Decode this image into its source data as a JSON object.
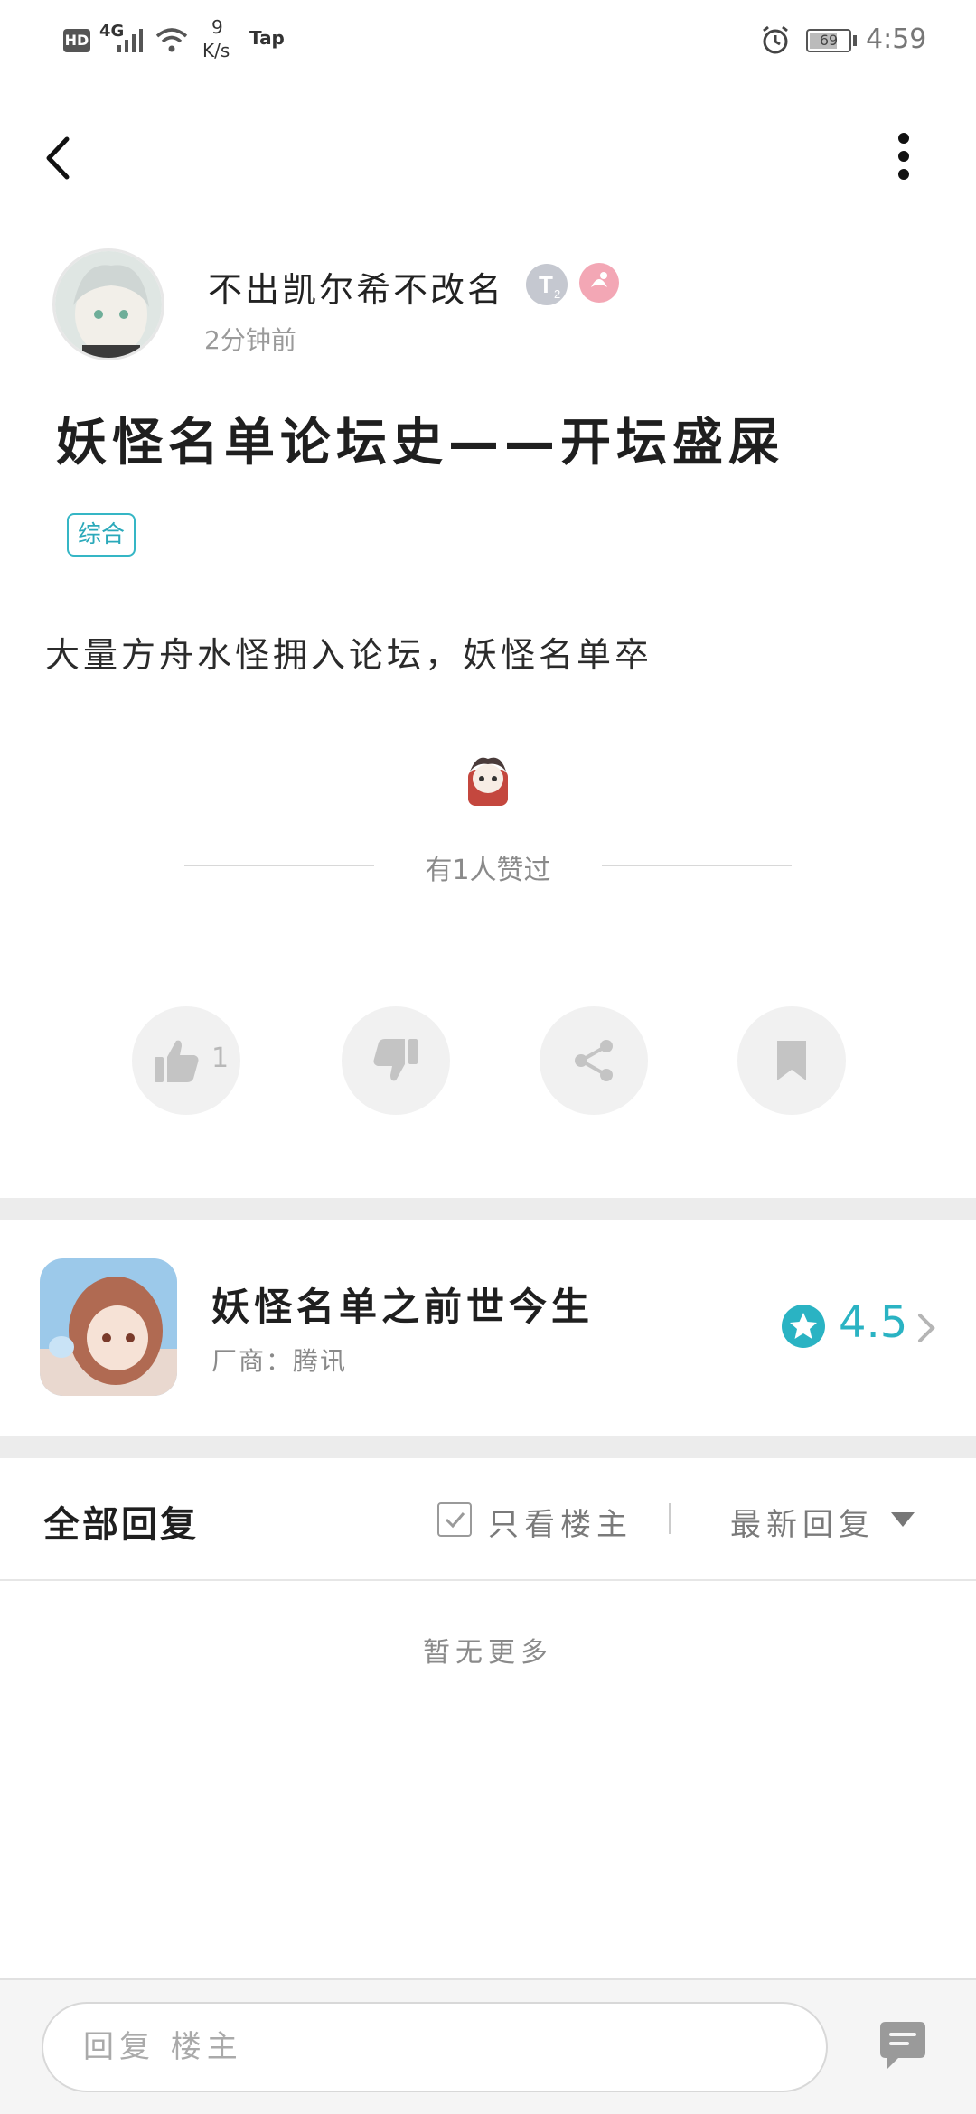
{
  "status_bar": {
    "network": "HD",
    "signal_type": "4G",
    "speed_value": "9",
    "speed_unit": "K/s",
    "app_badge": "Tap",
    "battery": "69",
    "time": "4:59"
  },
  "post": {
    "author": "不出凯尔希不改名",
    "time": "2分钟前",
    "title": "妖怪名单论坛史——开坛盛屎",
    "tag": "综合",
    "body": "大量方舟水怪拥入论坛，妖怪名单卒",
    "likes_text": "有1人赞过",
    "like_count": "1"
  },
  "game": {
    "name": "妖怪名单之前世今生",
    "vendor": "厂商：腾讯",
    "rating": "4.5"
  },
  "replies": {
    "title": "全部回复",
    "only_op": "只看楼主",
    "sort": "最新回复",
    "empty": "暂无更多"
  },
  "composer": {
    "placeholder": "回复 楼主"
  },
  "icons": {
    "back": "back-arrow-icon",
    "more": "more-vertical-icon",
    "like": "thumbs-up-icon",
    "dislike": "thumbs-down-icon",
    "share": "share-icon",
    "bookmark": "bookmark-icon",
    "star": "star-icon",
    "chat": "chat-bubble-icon"
  },
  "colors": {
    "accent": "#2ab3c3",
    "action_bg": "#f1f1f1",
    "icon_gray": "#c4c4c4"
  }
}
